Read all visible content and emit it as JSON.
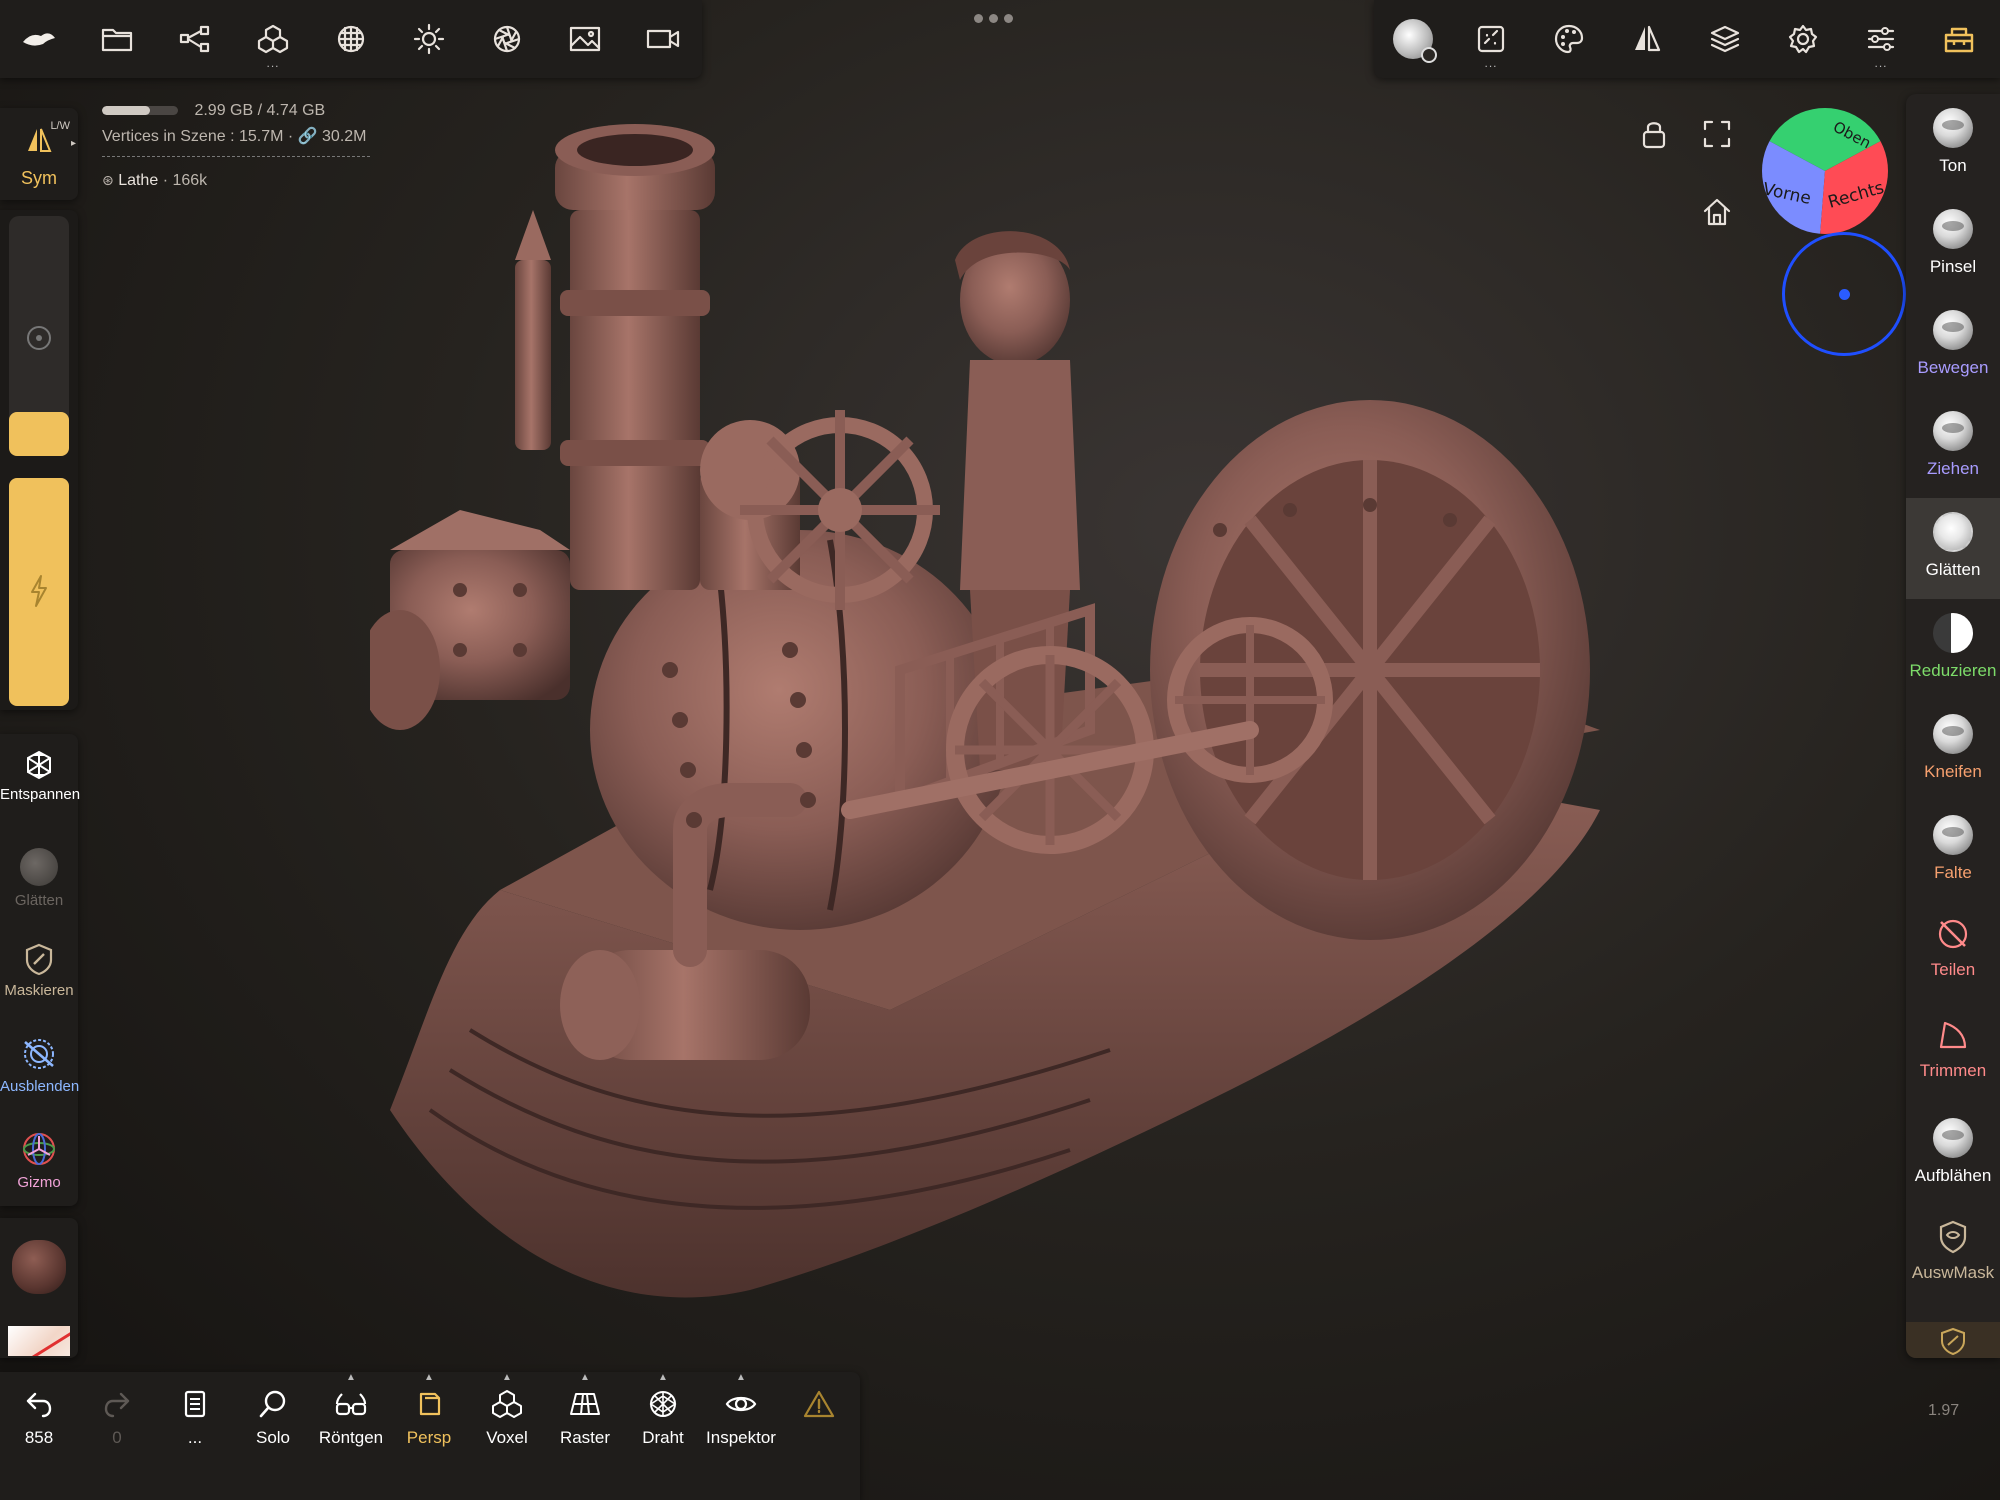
{
  "top_left_toolbar": [
    {
      "name": "nomad-logo-icon",
      "sub": ""
    },
    {
      "name": "folder-icon",
      "sub": ""
    },
    {
      "name": "share-nodes-icon",
      "sub": ""
    },
    {
      "name": "cubes-icon",
      "sub": "..."
    },
    {
      "name": "grid-sphere-icon",
      "sub": ""
    },
    {
      "name": "sun-icon",
      "sub": ""
    },
    {
      "name": "aperture-icon",
      "sub": ""
    },
    {
      "name": "image-icon",
      "sub": ""
    },
    {
      "name": "video-camera-icon",
      "sub": ""
    }
  ],
  "top_right_toolbar": [
    {
      "name": "brush-settings-icon",
      "sub": ""
    },
    {
      "name": "stroke-icon",
      "sub": "..."
    },
    {
      "name": "palette-icon",
      "sub": ""
    },
    {
      "name": "symmetry-icon",
      "sub": ""
    },
    {
      "name": "layers-icon",
      "sub": ""
    },
    {
      "name": "settings-gear-icon",
      "sub": ""
    },
    {
      "name": "sliders-icon",
      "sub": "..."
    },
    {
      "name": "toolbox-icon",
      "sub": ""
    }
  ],
  "info": {
    "memory": "2.99 GB / 4.74 GB",
    "memory_fraction": 0.63,
    "vertices": "Vertices in Szene : 15.7M · 🔗 30.2M",
    "object": "Lathe",
    "object_count": "· 166k"
  },
  "left": {
    "sym_label": "Sym",
    "sym_badge": "L/W",
    "tools": [
      {
        "name": "entspannen",
        "label": "Entspannen",
        "color": "#ffffff"
      },
      {
        "name": "glaetten",
        "label": "Glätten",
        "color": "#6b6560"
      },
      {
        "name": "maskieren",
        "label": "Maskieren",
        "color": "#c9b79a"
      },
      {
        "name": "ausblenden",
        "label": "Ausblenden",
        "color": "#8db7ff"
      },
      {
        "name": "gizmo",
        "label": "Gizmo",
        "color": "#f1a3d8"
      }
    ]
  },
  "right_tools": [
    {
      "name": "ton",
      "label": "Ton",
      "color": "#ffffff"
    },
    {
      "name": "pinsel",
      "label": "Pinsel",
      "color": "#ffffff"
    },
    {
      "name": "bewegen",
      "label": "Bewegen",
      "color": "#a99cff"
    },
    {
      "name": "ziehen",
      "label": "Ziehen",
      "color": "#a99cff"
    },
    {
      "name": "glaetten",
      "label": "Glätten",
      "color": "#ffffff"
    },
    {
      "name": "reduzieren",
      "label": "Reduzieren",
      "color": "#7ddc6a"
    },
    {
      "name": "kneifen",
      "label": "Kneifen",
      "color": "#f6a06e"
    },
    {
      "name": "falte",
      "label": "Falte",
      "color": "#f6a06e"
    },
    {
      "name": "teilen",
      "label": "Teilen",
      "color": "#ff8a8a"
    },
    {
      "name": "trimmen",
      "label": "Trimmen",
      "color": "#ff8a8a"
    },
    {
      "name": "aufblaehen",
      "label": "Aufblähen",
      "color": "#ffffff"
    },
    {
      "name": "auswmask",
      "label": "AuswMask",
      "color": "#c9b79a"
    }
  ],
  "bottom": [
    {
      "name": "undo",
      "label": "858",
      "color": "#ffffff"
    },
    {
      "name": "redo",
      "label": "0",
      "color": "#5e5955"
    },
    {
      "name": "history",
      "label": "...",
      "color": "#ffffff"
    },
    {
      "name": "solo",
      "label": "Solo",
      "color": "#ffffff"
    },
    {
      "name": "roentgen",
      "label": "Röntgen",
      "color": "#ffffff"
    },
    {
      "name": "persp",
      "label": "Persp",
      "color": "#f0c15c"
    },
    {
      "name": "voxel",
      "label": "Voxel",
      "color": "#ffffff"
    },
    {
      "name": "raster",
      "label": "Raster",
      "color": "#ffffff"
    },
    {
      "name": "draht",
      "label": "Draht",
      "color": "#ffffff"
    },
    {
      "name": "inspektor",
      "label": "Inspektor",
      "color": "#ffffff"
    },
    {
      "name": "warning",
      "label": "",
      "color": "#f0c15c"
    }
  ],
  "version": "1.97",
  "cube_faces": {
    "top": "Oben",
    "front": "Vorne",
    "right": "Rechts"
  },
  "colors": {
    "accent": "#f0c15c",
    "orbit": "#1f4fff",
    "model": "#8a5d55"
  }
}
